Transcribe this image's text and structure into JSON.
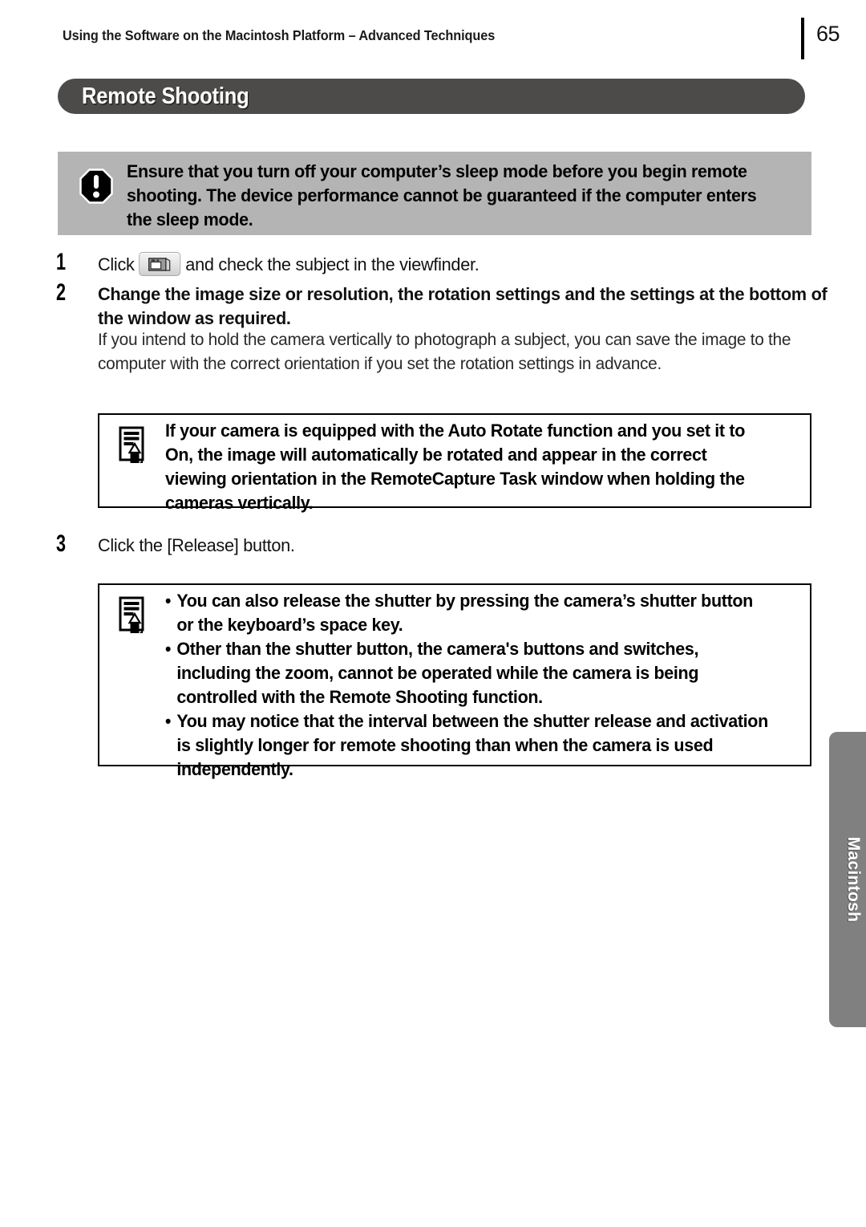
{
  "header": {
    "title": "Using the Software on the Macintosh Platform – Advanced Techniques",
    "page_number": "65"
  },
  "section": {
    "banner_title": "Remote Shooting"
  },
  "caution": {
    "icon": "exclamation-octagon-icon",
    "text": "Ensure that you turn off your computer’s sleep mode before you begin remote shooting. The device performance cannot be guaranteed if the computer enters the sleep mode."
  },
  "steps": [
    {
      "number": "1",
      "text_before_icon": "Click",
      "inline_icon": "camera-viewfinder-button-icon",
      "text_after_icon": "and check the subject in the viewfinder."
    },
    {
      "number": "2",
      "text": "Change the image size or resolution, the rotation settings and the settings at the bottom of the window as required."
    },
    {
      "number": "3",
      "text": "Click the [Release] button."
    }
  ],
  "paragraph": "If you intend to hold the camera vertically to photograph a subject, you can save the image to the computer with the correct orientation if you set the rotation settings in advance.",
  "note1": {
    "icon": "memo-pencil-icon",
    "text": "If your camera is equipped with the Auto Rotate function and you set it to On, the image will automatically be rotated and appear in the correct viewing orientation in the RemoteCapture Task window when holding the cameras vertically."
  },
  "note2": {
    "icon": "memo-pencil-icon",
    "bullet": "•",
    "items": [
      "You can also release the shutter by pressing the camera’s shutter button or the keyboard’s space key.",
      "Other than the shutter button, the camera's buttons and switches, including the zoom, cannot be operated while the camera is being controlled with the Remote Shooting function.",
      "You may notice that the interval between the shutter release and activation is slightly longer for remote shooting than when the camera is used independently."
    ]
  },
  "side_tab": {
    "label": "Macintosh"
  },
  "colors": {
    "banner_bg": "#4d4b4a",
    "caution_bg": "#b4b4b4",
    "side_tab_bg": "#808080",
    "page_bg": "#ffffff",
    "text": "#000000"
  }
}
